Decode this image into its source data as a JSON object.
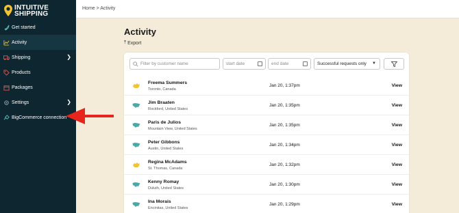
{
  "brand": {
    "line1": "INTUITIVE",
    "line2": "SHIPPING",
    "pin_color": "#f2c230"
  },
  "sidebar": {
    "items": [
      {
        "label": "Get started",
        "icon": "rocket-icon",
        "chevron": false,
        "active": false
      },
      {
        "label": "Activity",
        "icon": "chart-icon",
        "chevron": false,
        "active": true
      },
      {
        "label": "Shipping",
        "icon": "truck-icon",
        "chevron": true,
        "active": false
      },
      {
        "label": "Products",
        "icon": "tag-icon",
        "chevron": false,
        "active": false
      },
      {
        "label": "Packages",
        "icon": "box-icon",
        "chevron": false,
        "active": false
      },
      {
        "label": "Settings",
        "icon": "gear-icon",
        "chevron": true,
        "active": false
      },
      {
        "label": "BigCommerce connection",
        "icon": "plug-icon",
        "chevron": false,
        "active": false
      }
    ]
  },
  "breadcrumb": "Home > Activity",
  "page": {
    "title": "Activity",
    "export_label": "Export"
  },
  "filters": {
    "search_placeholder": "Filter by customer name",
    "start_date_placeholder": "start date",
    "end_date_placeholder": "end date",
    "status_selected": "Successful requests only"
  },
  "activity": [
    {
      "name": "Freema Summers",
      "location": "Toronto, Canada",
      "date": "Jan 20, 1:37pm",
      "action": "View",
      "country": "CA"
    },
    {
      "name": "Jim Braaten",
      "location": "Rockford, United States",
      "date": "Jan 20, 1:35pm",
      "action": "View",
      "country": "US"
    },
    {
      "name": "Paris de Julios",
      "location": "Mountain View, United States",
      "date": "Jan 20, 1:35pm",
      "action": "View",
      "country": "US"
    },
    {
      "name": "Peter Gibbons",
      "location": "Austin, United States",
      "date": "Jan 20, 1:34pm",
      "action": "View",
      "country": "US"
    },
    {
      "name": "Regina McAdams",
      "location": "St. Thomas, Canada",
      "date": "Jan 20, 1:32pm",
      "action": "View",
      "country": "CA"
    },
    {
      "name": "Kenny Romay",
      "location": "Duluth, United States",
      "date": "Jan 20, 1:30pm",
      "action": "View",
      "country": "US"
    },
    {
      "name": "Ina Morais",
      "location": "Encinitas, United States",
      "date": "Jan 20, 1:29pm",
      "action": "View",
      "country": "US"
    }
  ],
  "colors": {
    "sidebar_bg": "#0d2630",
    "page_bg": "#f4ecd8",
    "arrow": "#e8251c",
    "canada_flag": "#f0c435",
    "usa_flag": "#4aa8a8"
  }
}
